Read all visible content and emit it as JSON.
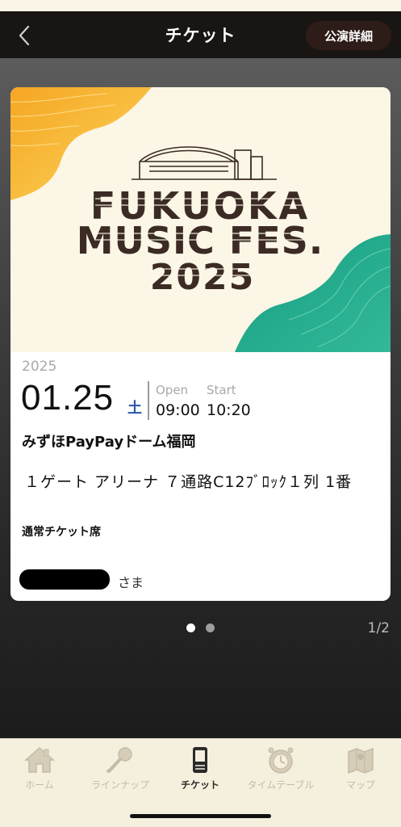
{
  "navbar": {
    "title": "チケット",
    "detail_button": "公演詳細"
  },
  "hero": {
    "logo_lines": [
      "FUKUOKA",
      "MUSIC FES.",
      "2025"
    ],
    "colors": {
      "yellow": "#f7b82a",
      "green": "#1aa58a",
      "cream": "#fbf6e6",
      "brown": "#3b2b24"
    }
  },
  "ticket": {
    "year": "2025",
    "date": "01.25",
    "day_of_week": "土",
    "open_label": "Open",
    "start_label": "Start",
    "open_time": "09:00",
    "start_time": "10:20",
    "venue": "みずほPayPayドーム福岡",
    "seat": "１ゲート アリーナ ７通路C12ﾌﾞﾛｯｸ１列 1番",
    "ticket_type": "通常チケット席",
    "holder_suffix": "さま"
  },
  "pager": {
    "counter": "1/2",
    "dots": 2,
    "active_index": 0
  },
  "tabbar": {
    "items": [
      {
        "label": "ホーム",
        "icon": "home-icon",
        "active": false
      },
      {
        "label": "ラインナップ",
        "icon": "microphone-icon",
        "active": false
      },
      {
        "label": "チケット",
        "icon": "ticket-icon",
        "active": true
      },
      {
        "label": "タイムテーブル",
        "icon": "clock-icon",
        "active": false
      },
      {
        "label": "マップ",
        "icon": "map-icon",
        "active": false
      }
    ]
  }
}
